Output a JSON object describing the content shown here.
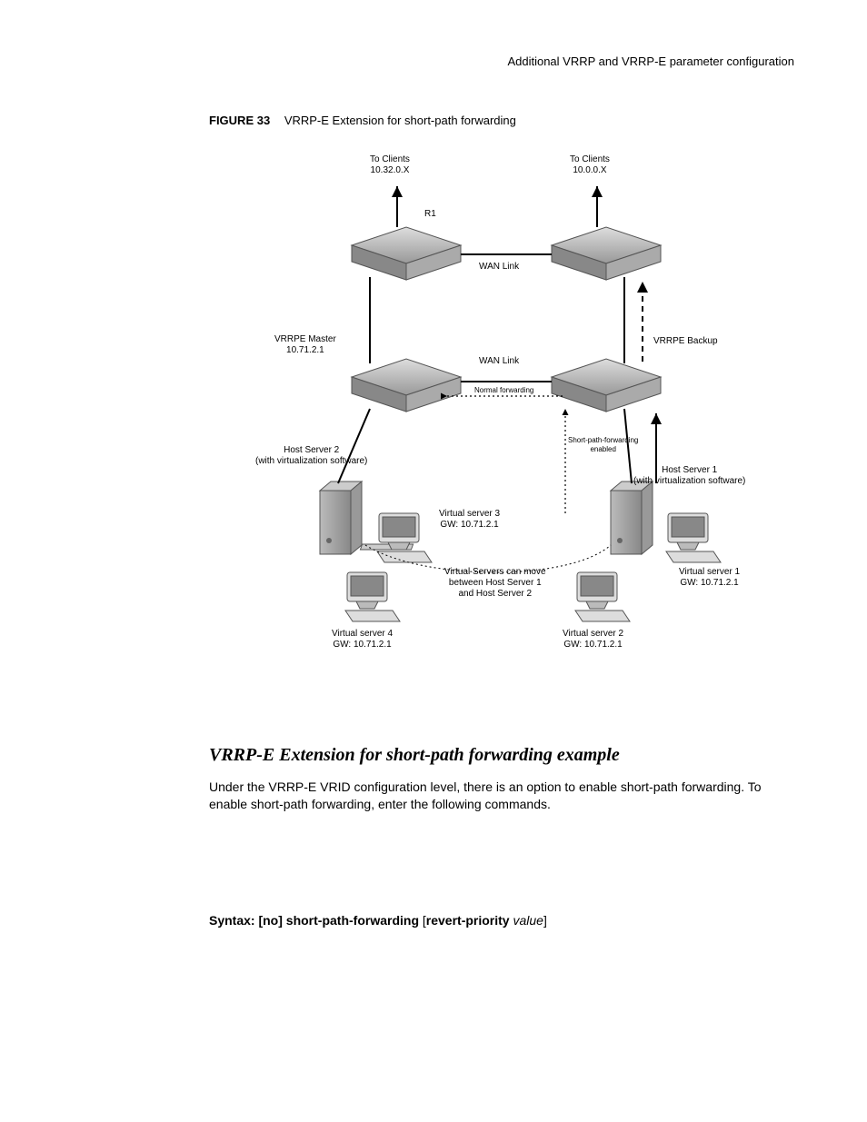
{
  "running_head": "Additional VRRP and VRRP-E parameter configuration",
  "figure": {
    "label": "FIGURE 33",
    "title": "VRRP-E Extension for short-path forwarding",
    "labels": {
      "to_clients_left_line1": "To Clients",
      "to_clients_left_line2": "10.32.0.X",
      "to_clients_right_line1": "To Clients",
      "to_clients_right_line2": "10.0.0.X",
      "r1": "R1",
      "wan_link_upper": "WAN Link",
      "wan_link_lower": "WAN Link",
      "vrrpe_master_line1": "VRRPE Master",
      "vrrpe_master_line2": "10.71.2.1",
      "vrrpe_backup": "VRRPE Backup",
      "normal_forwarding": "Normal forwarding",
      "short_path_enabled_line1": "Short-path-forwarding",
      "short_path_enabled_line2": "enabled",
      "host_server_2_line1": "Host Server 2",
      "host_server_2_line2": "(with virtualization software)",
      "host_server_1_line1": "Host Server 1",
      "host_server_1_line2": "(with virtualization software)",
      "vs3_line1": "Virtual server 3",
      "vs3_line2": "GW: 10.71.2.1",
      "vs_move_line1": "Virtual Servers can move",
      "vs_move_line2": "between Host Server 1",
      "vs_move_line3": "and Host Server 2",
      "vs4_line1": "Virtual server 4",
      "vs4_line2": "GW: 10.71.2.1",
      "vs2_line1": "Virtual server 2",
      "vs2_line2": "GW: 10.71.2.1",
      "vs1_line1": "Virtual server 1",
      "vs1_line2": "GW: 10.71.2.1"
    }
  },
  "section_heading": "VRRP-E Extension for short-path forwarding example",
  "body_paragraph": "Under the VRRP-E VRID configuration level, there is an option to enable short-path forwarding. To enable short-path forwarding, enter the following commands.",
  "syntax": {
    "prefix": "Syntax:",
    "cmd": " [no] short-path-forwarding",
    "option_open": " [",
    "option_kw": "revert-priority",
    "option_val": " value",
    "option_close": "]"
  }
}
